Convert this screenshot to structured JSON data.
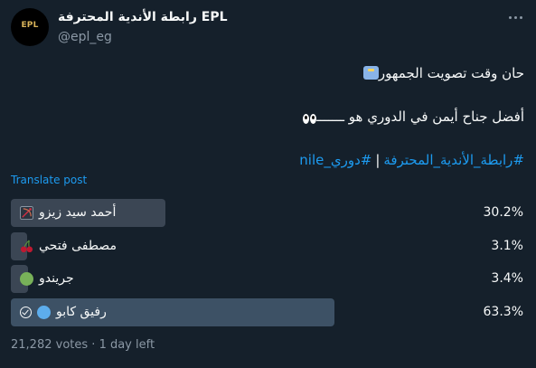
{
  "account": {
    "display_name": "رابطة الأندية المحترفة EPL",
    "handle": "@epl_eg",
    "avatar_text": "EPL"
  },
  "post": {
    "line1_text": "حان وقت تصويت الجمهور",
    "line1_icon": "ballot-box-icon",
    "line2_text": "أفضل جناح أيمن في الدوري هو ـــــــ",
    "line2_icon": "eyes-icon",
    "hashtag1": "#رابطة_الأندية_المحترفة",
    "separator": "|",
    "hashtag2": "#دوري_nile"
  },
  "translate_label": "Translate post",
  "poll": {
    "options": [
      {
        "label": "أحمد سيد زيزو",
        "percent_text": "30.2%",
        "percent": 30.2,
        "icon": "bow-and-arrow-icon",
        "selected": false
      },
      {
        "label": "مصطفى فتحي",
        "percent_text": "3.1%",
        "percent": 3.1,
        "icon": "cherries-icon",
        "selected": false
      },
      {
        "label": "جريندو",
        "percent_text": "3.4%",
        "percent": 3.4,
        "icon": "green-circle-icon",
        "selected": false
      },
      {
        "label": "رفيق كابو",
        "percent_text": "63.3%",
        "percent": 63.3,
        "icon": "blue-circle-icon",
        "selected": true
      }
    ],
    "votes": "21,282 votes",
    "separator": "·",
    "time_left": "1 day left"
  },
  "colors": {
    "background": "#15202b",
    "link": "#1d9bf0",
    "bar": "#3b4654",
    "bar_winner": "#3d5165"
  }
}
